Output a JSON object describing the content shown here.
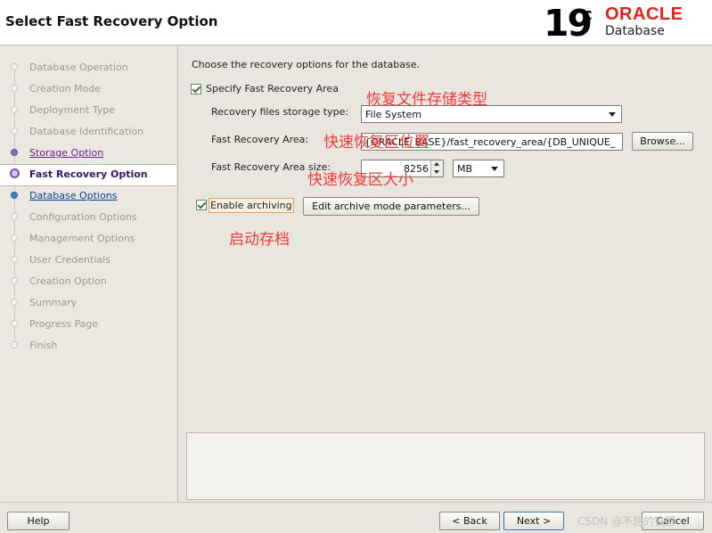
{
  "window": {
    "title": "Select Fast Recovery Option",
    "logo_version": "19",
    "logo_version_suffix": "c",
    "logo_brand": "ORACLE",
    "logo_product": "Database"
  },
  "sidebar": {
    "steps": [
      {
        "label": "Database Operation",
        "state": "inactive"
      },
      {
        "label": "Creation Mode",
        "state": "inactive"
      },
      {
        "label": "Deployment Type",
        "state": "inactive"
      },
      {
        "label": "Database Identification",
        "state": "inactive"
      },
      {
        "label": "Storage Option",
        "state": "done"
      },
      {
        "label": "Fast Recovery Option",
        "state": "current"
      },
      {
        "label": "Database Options",
        "state": "next"
      },
      {
        "label": "Configuration Options",
        "state": "inactive"
      },
      {
        "label": "Management Options",
        "state": "inactive"
      },
      {
        "label": "User Credentials",
        "state": "inactive"
      },
      {
        "label": "Creation Option",
        "state": "inactive"
      },
      {
        "label": "Summary",
        "state": "inactive"
      },
      {
        "label": "Progress Page",
        "state": "inactive"
      },
      {
        "label": "Finish",
        "state": "inactive"
      }
    ]
  },
  "main": {
    "intro": "Choose the recovery options for the database.",
    "specify_fra": {
      "label": "Specify Fast Recovery Area",
      "checked": true
    },
    "storage_type": {
      "label": "Recovery files storage type:",
      "value": "File System"
    },
    "fra_location": {
      "label": "Fast Recovery Area:",
      "value": "{ORACLE_BASE}/fast_recovery_area/{DB_UNIQUE_",
      "browse_label": "Browse..."
    },
    "fra_size": {
      "label": "Fast Recovery Area size:",
      "value": "8256",
      "unit": "MB"
    },
    "archiving": {
      "label": "Enable archiving",
      "checked": true,
      "edit_label": "Edit archive mode parameters..."
    }
  },
  "annotations": {
    "storage_type": "恢复文件存储类型",
    "fra_location": "快速恢复区位置",
    "fra_size": "快速恢复区大小",
    "archiving": "启动存档"
  },
  "footer": {
    "help": "Help",
    "back": "< Back",
    "next": "Next >",
    "cancel": "Cancel",
    "watermark": "CSDN @不屈的铁壁"
  },
  "colors": {
    "accent_purple": "#6b1e8a",
    "link_blue": "#0a3f8f",
    "annotation_red": "#ef3b3b",
    "oracle_red": "#e2231a"
  }
}
